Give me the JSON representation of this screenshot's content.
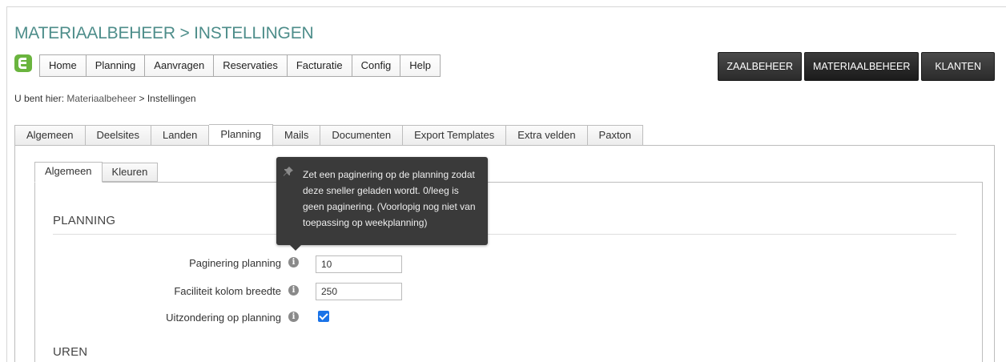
{
  "header": {
    "title": "MATERIAALBEHEER > INSTELLINGEN"
  },
  "menu": {
    "items": [
      {
        "label": "Home"
      },
      {
        "label": "Planning"
      },
      {
        "label": "Aanvragen"
      },
      {
        "label": "Reservaties"
      },
      {
        "label": "Facturatie"
      },
      {
        "label": "Config"
      },
      {
        "label": "Help"
      }
    ]
  },
  "modules": {
    "buttons": [
      {
        "label": "ZAALBEHEER"
      },
      {
        "label": "MATERIAALBEHEER",
        "active": true
      },
      {
        "label": "KLANTEN"
      }
    ]
  },
  "breadcrumb": {
    "prefix": "U bent hier:",
    "link": "Materiaalbeheer",
    "separator": ">",
    "current": "Instellingen"
  },
  "tabs": {
    "items": [
      {
        "label": "Algemeen"
      },
      {
        "label": "Deelsites"
      },
      {
        "label": "Landen"
      },
      {
        "label": "Planning",
        "active": true
      },
      {
        "label": "Mails"
      },
      {
        "label": "Documenten"
      },
      {
        "label": "Export Templates"
      },
      {
        "label": "Extra velden"
      },
      {
        "label": "Paxton"
      }
    ]
  },
  "subtabs": {
    "items": [
      {
        "label": "Algemeen",
        "active": true
      },
      {
        "label": "Kleuren"
      }
    ]
  },
  "sections": {
    "planning": "PLANNING",
    "uren": "UREN"
  },
  "form": {
    "paginering_label": "Paginering planning",
    "paginering_value": "10",
    "kolom_label": "Faciliteit kolom breedte",
    "kolom_value": "250",
    "uitzondering_label": "Uitzondering op planning",
    "uitzondering_checked": true
  },
  "tooltip": {
    "text": "Zet een paginering op de planning zodat deze sneller geladen wordt. 0/leeg is geen paginering. (Voorlopig nog niet van toepassing op weekplanning)"
  },
  "colors": {
    "title": "#4d8d8a",
    "logo": "#6ab43e",
    "module_button": "#2b2b2b",
    "checkbox": "#1a73e8",
    "tooltip_bg": "#3a3a3a"
  },
  "icons": {
    "info": "info-circle-icon",
    "pin": "pin-icon",
    "logo": "app-logo-icon"
  }
}
